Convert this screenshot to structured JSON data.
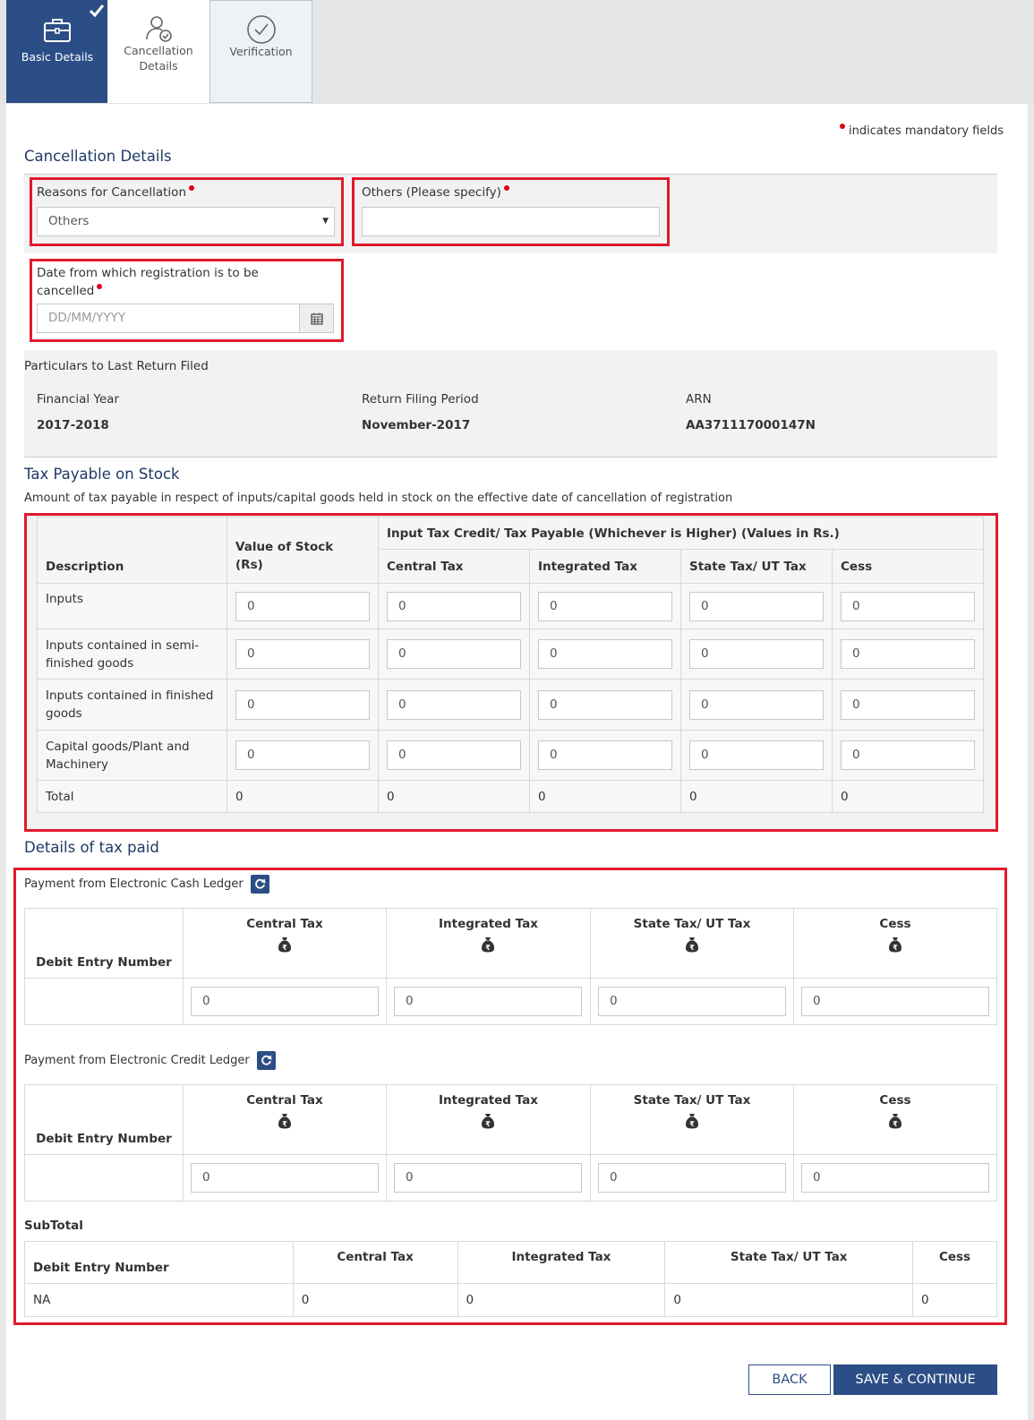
{
  "tabs": [
    {
      "label": "Basic Details",
      "icon": "briefcase-icon",
      "active": true
    },
    {
      "label_line1": "Cancellation",
      "label_line2": "Details",
      "icon": "user-check-icon"
    },
    {
      "label": "Verification",
      "icon": "check-circle-icon"
    }
  ],
  "mandatory_note": "indicates mandatory fields",
  "cancellation": {
    "title": "Cancellation Details",
    "reason_label": "Reasons for Cancellation",
    "reason_value": "Others",
    "others_label": "Others (Please specify)",
    "others_value": "",
    "date_label_line1": "Date from which registration is to be",
    "date_label_line2": "cancelled",
    "date_placeholder": "DD/MM/YYYY"
  },
  "last_return": {
    "title": "Particulars to Last Return Filed",
    "fy_label": "Financial Year",
    "fy_value": "2017-2018",
    "period_label": "Return Filing Period",
    "period_value": "November-2017",
    "arn_label": "ARN",
    "arn_value": "AA371117000147N"
  },
  "stock": {
    "title": "Tax Payable on Stock",
    "subtitle": "Amount of tax payable in respect of inputs/capital goods held in stock on the effective date of cancellation of registration",
    "col_description": "Description",
    "col_value_line1": "Value of Stock",
    "col_value_line2": "(Rs)",
    "col_group": "Input Tax Credit/ Tax Payable (Whichever is Higher) (Values in Rs.)",
    "col_central": "Central Tax",
    "col_integrated": "Integrated Tax",
    "col_state": "State Tax/ UT Tax",
    "col_cess": "Cess",
    "rows": [
      {
        "line1": "Inputs",
        "line2": "",
        "values": [
          "0",
          "0",
          "0",
          "0",
          "0"
        ]
      },
      {
        "line1": "Inputs contained in semi-",
        "line2": "finished goods",
        "values": [
          "0",
          "0",
          "0",
          "0",
          "0"
        ]
      },
      {
        "line1": "Inputs contained in finished",
        "line2": "goods",
        "values": [
          "0",
          "0",
          "0",
          "0",
          "0"
        ]
      },
      {
        "line1": "Capital goods/Plant and",
        "line2": "Machinery",
        "values": [
          "0",
          "0",
          "0",
          "0",
          "0"
        ]
      }
    ],
    "total_label": "Total",
    "totals": [
      "0",
      "0",
      "0",
      "0",
      "0"
    ]
  },
  "tax_paid": {
    "title": "Details of tax paid",
    "cash_label": "Payment from Electronic Cash Ledger",
    "credit_label": "Payment from Electronic Credit Ledger",
    "col_debit": "Debit Entry Number",
    "col_central": "Central Tax",
    "col_integrated": "Integrated Tax",
    "col_state": "State Tax/ UT Tax",
    "col_cess": "Cess",
    "cash_values": [
      "0",
      "0",
      "0",
      "0"
    ],
    "credit_values": [
      "0",
      "0",
      "0",
      "0"
    ],
    "subtotal_title": "SubTotal",
    "subtotal_debit": "NA",
    "subtotal_values": [
      "0",
      "0",
      "0",
      "0"
    ]
  },
  "buttons": {
    "back": "BACK",
    "save": "SAVE & CONTINUE"
  },
  "colors": {
    "primary": "#2c4e86",
    "highlight": "#e01a2b",
    "required": "#e0001b"
  }
}
